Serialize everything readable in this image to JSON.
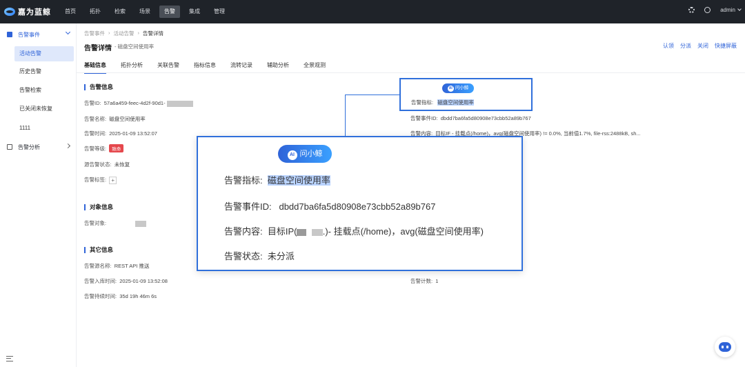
{
  "app": {
    "logo_text": "嘉为蓝鲸"
  },
  "topnav": {
    "items": [
      "首页",
      "拓扑",
      "检索",
      "场景",
      "告警",
      "集成",
      "管理"
    ],
    "active_index": 4,
    "user": "admin"
  },
  "sidebar": {
    "group1": "告警事件",
    "items": [
      "活动告警",
      "历史告警",
      "告警检索",
      "已关闭未恢复",
      "1111"
    ],
    "active_index": 0,
    "group2": "告警分析"
  },
  "breadcrumb": [
    "告警事件",
    "活动告警",
    "告警详情"
  ],
  "header": {
    "title": "告警详情",
    "subtitle": "- 磁盘空间使用率"
  },
  "actions": [
    "认领",
    "分派",
    "关闭",
    "快捷屏蔽"
  ],
  "tabs": [
    "基础信息",
    "拓扑分析",
    "关联告警",
    "指标信息",
    "流转记录",
    "辅助分析",
    "全景观测"
  ],
  "alert_info": {
    "section": "告警信息",
    "id_label": "告警ID:",
    "id_value": "57a6a459-feec-4d2f-90d1-",
    "name_label": "告警名称:",
    "name_value": "磁盘空间使用率",
    "time_label": "告警时间:",
    "time_value": "2025-01-09 13:52:07",
    "level_label": "告警等级:",
    "level_value": "致命",
    "source_state_label": "源告警状态:",
    "source_state_value": "未恢复",
    "tags_label": "告警标签:",
    "tag_add": "+"
  },
  "object_info": {
    "section": "对象信息",
    "object_label": "告警对象:"
  },
  "other_info": {
    "section": "其它信息",
    "source_name_label": "告警源名称:",
    "source_name_value": "REST API 推送",
    "ingest_time_label": "告警入库时间:",
    "ingest_time_value": "2025-01-09 13:52:08",
    "duration_label": "告警持续时间:",
    "duration_value": "35d 19h 46m 6s",
    "count_label": "告警计数:",
    "count_value": "1"
  },
  "right_col": {
    "metric_label": "告警指标:",
    "metric_value": "磁盘空间使用率",
    "event_id_label": "告警事件ID:",
    "event_id_value": "dbdd7ba6fa5d80908e73cbb52a89b767",
    "content_label": "告警内容:",
    "content_value": "目标IF                         - 挂载点(/home)，avg(磁盘空间使用率) != 0.0%, 当前值1.7%, file-rss:2488kB, sh..."
  },
  "ai_button": "问小鲸",
  "ai_icon_text": "AI",
  "zoom": {
    "metric_label": "告警指标:",
    "metric_value": "磁盘空间使用率",
    "event_id_label": "告警事件ID:",
    "event_id_value": "dbdd7ba6fa5d80908e73cbb52a89b767",
    "content_label": "告警内容:",
    "content_prefix": "目标IP(",
    "content_suffix": ".)- 挂载点(/home)，avg(磁盘空间使用率)",
    "status_label": "告警状态:",
    "status_value": "未分派"
  }
}
